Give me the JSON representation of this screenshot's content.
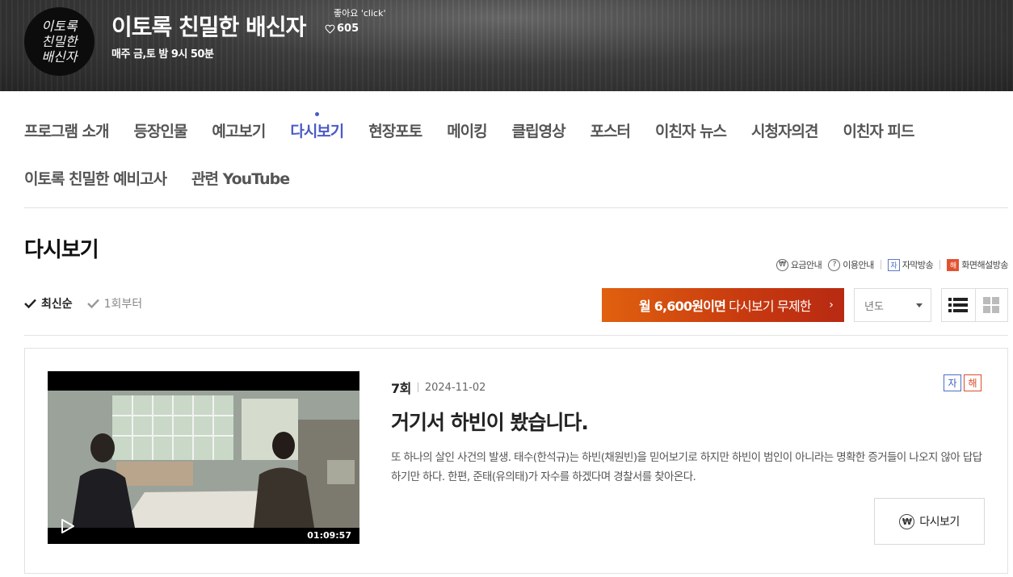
{
  "header": {
    "logo_lines": [
      "이토록",
      "친밀한",
      "배신자"
    ],
    "title": "이토록 친밀한 배신자",
    "like_label": "좋아요 'click'",
    "like_count": "605",
    "schedule": "매주 금,토 밤 9시 50분"
  },
  "nav": {
    "row1": [
      "프로그램 소개",
      "등장인물",
      "예고보기",
      "다시보기",
      "현장포토",
      "메이킹",
      "클립영상",
      "포스터",
      "이친자 뉴스",
      "시청자의견",
      "이친자 피드"
    ],
    "row2": [
      "이토록 친밀한 예비고사",
      "관련 YouTube"
    ],
    "active": "다시보기"
  },
  "section": {
    "title": "다시보기",
    "info_links": {
      "fee": "요금안내",
      "usage": "이용안내",
      "subtitle": "자막방송",
      "subtitle_mark": "자",
      "audio_desc": "화면해설방송",
      "audio_desc_mark": "해"
    },
    "sort": {
      "latest": "최신순",
      "first": "1회부터"
    },
    "promo": {
      "bold": "월 6,600원이면",
      "rest": "다시보기 무제한",
      "arrow": "›"
    },
    "year_select": {
      "value": "년도"
    }
  },
  "episode": {
    "number": "7회",
    "date": "2024-11-02",
    "title": "거기서 하빈이 봤습니다.",
    "description": "또 하나의 살인 사건의 발생. 태수(한석규)는 하빈(채원빈)을 믿어보기로 하지만 하빈이 범인이 아니라는 명확한 증거들이 나오지 않아 답답하기만 하다. 한편, 준태(유의태)가 자수를 하겠다며 경찰서를 찾아온다.",
    "duration": "01:09:57",
    "badge_sub": "자",
    "badge_desc": "해",
    "rewatch_label": "다시보기",
    "won_symbol": "₩"
  },
  "colors": {
    "accent": "#4a5bc4",
    "promo_start": "#e0610f",
    "promo_end": "#b82a12",
    "badge_blue": "#3f5fc4",
    "badge_red": "#dc4d2c"
  }
}
